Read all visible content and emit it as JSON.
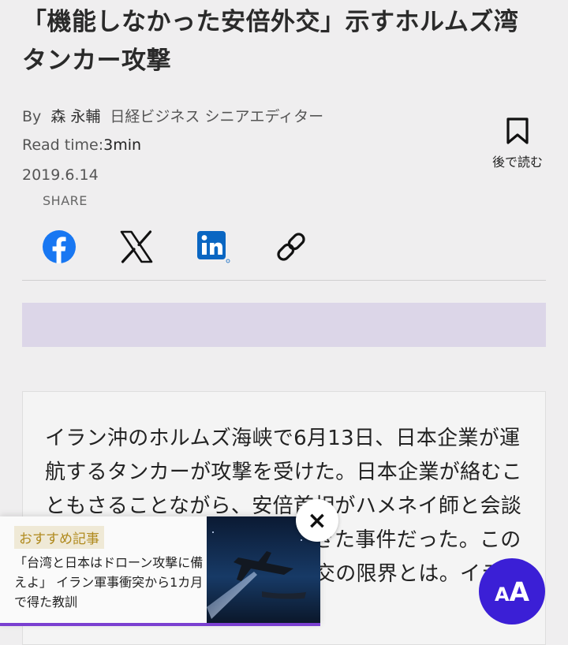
{
  "article": {
    "title": "「機能しなかった安倍外交」示すホルムズ湾タンカー攻撃",
    "by_label": "By",
    "author": "森 永輔",
    "author_role": "日経ビジネス シニアエディター",
    "read_time_label": "Read time:",
    "read_time_value": "3min",
    "date": "2019.6.14",
    "body": "イラン沖のホルムズ海峡で6月13日、日本企業が運航するタンカーが攻撃を受けた。日本企業が絡むこともさることながら、安倍首相がハメネイ師と会談するタイミングをとらえて起きた事件だった。この事態から浮かび上がる安倍外交の限界とは。イラン大使を務め"
  },
  "bookmark": {
    "label": "後で読む",
    "icon": "bookmark-icon"
  },
  "share": {
    "label": "SHARE",
    "items": [
      {
        "name": "facebook",
        "icon": "facebook-icon",
        "color": "#1877f2"
      },
      {
        "name": "x",
        "icon": "x-icon",
        "color": "#111111"
      },
      {
        "name": "linkedin",
        "icon": "linkedin-icon",
        "color": "#0a66c2"
      },
      {
        "name": "copy-link",
        "icon": "link-icon",
        "color": "#111111"
      }
    ]
  },
  "recommendation": {
    "tag": "おすすめ記事",
    "text": "「台湾と日本はドローン攻撃に備えよ」 イラン軍事衝突から1カ月で得た教訓"
  },
  "font_size_button": {
    "small": "A",
    "big": "A"
  },
  "close_icon": "×",
  "colors": {
    "background": "#efeeef",
    "ad_slot": "#dcd6e8",
    "accent": "#3b1fd6",
    "tag_text": "#b08a1e"
  }
}
